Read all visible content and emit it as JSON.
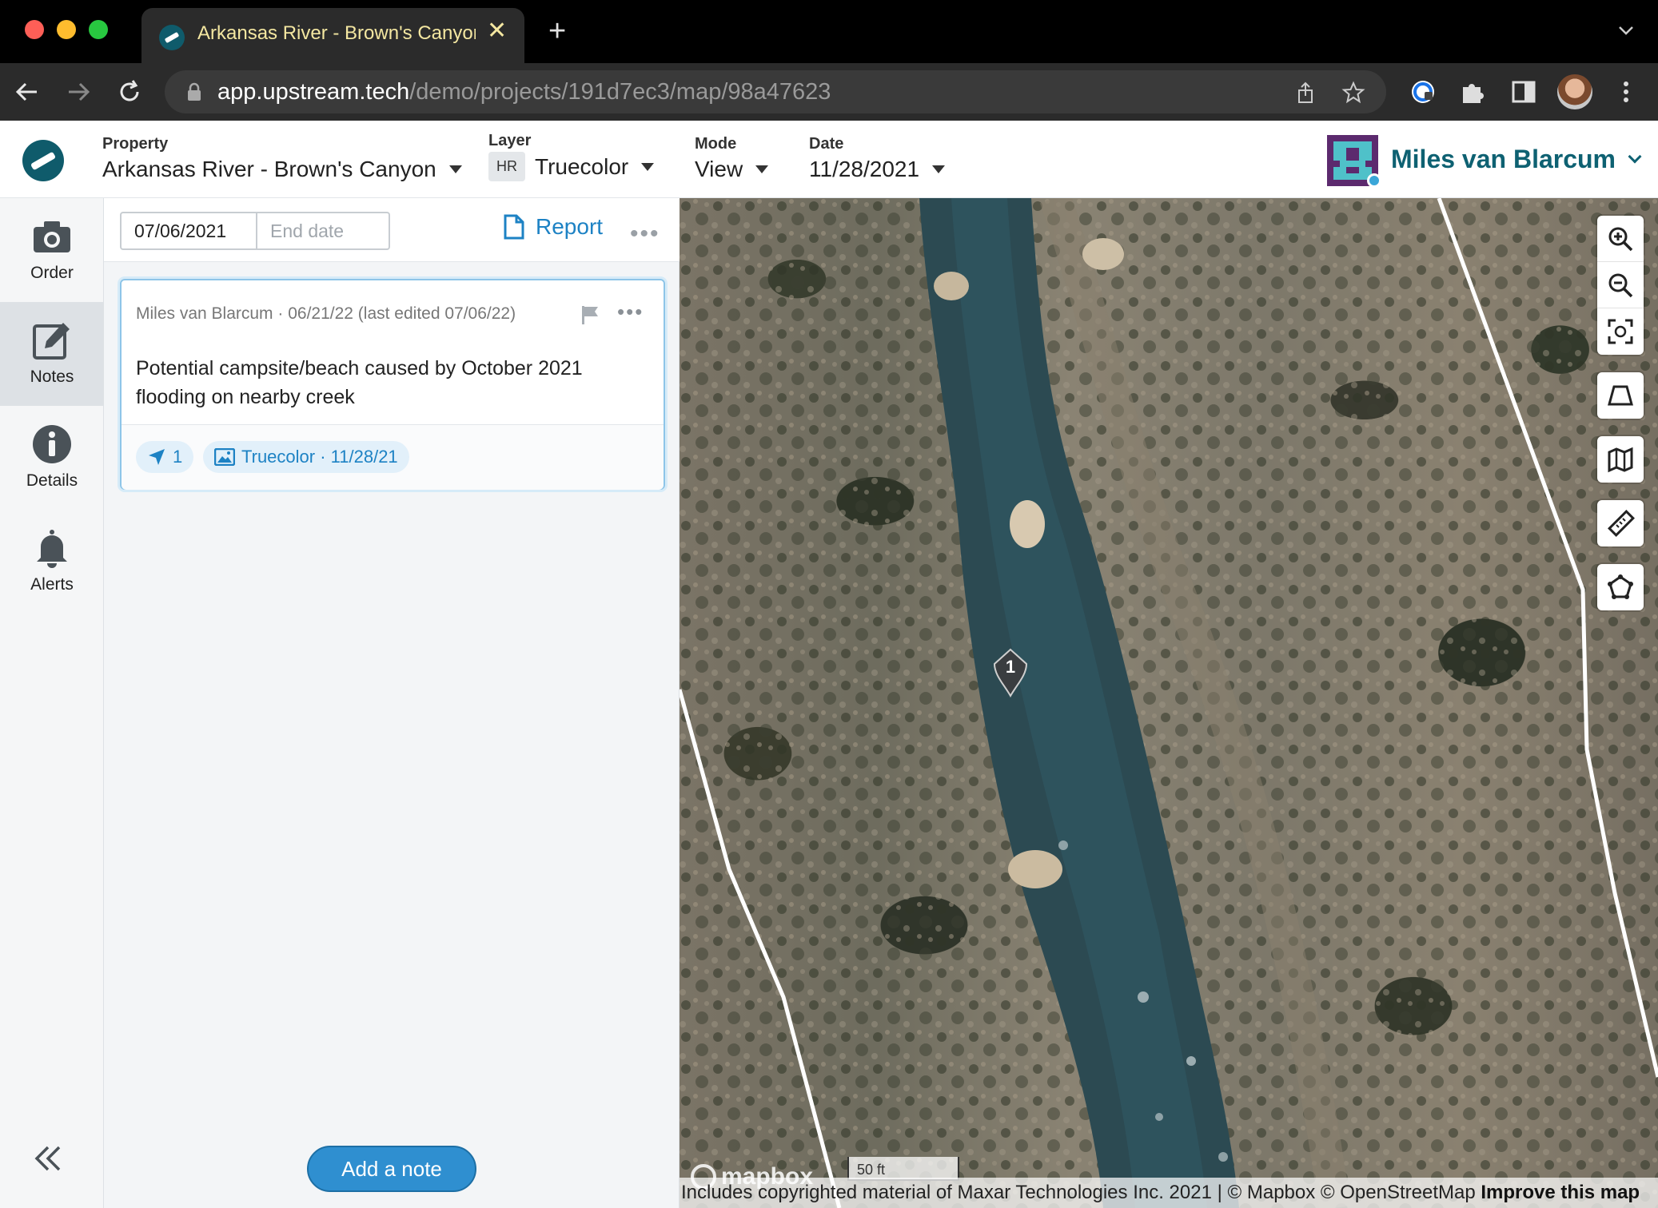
{
  "browser": {
    "tab_title": "Arkansas River - Brown's Canyon",
    "tab_close": "✕",
    "new_tab": "+",
    "url_host": "app.upstream.tech",
    "url_path": "/demo/projects/191d7ec3/map/98a47623"
  },
  "header": {
    "property_label": "Property",
    "property_value": "Arkansas River - Brown's Canyon",
    "layer_label": "Layer",
    "layer_badge": "HR",
    "layer_value": "Truecolor",
    "mode_label": "Mode",
    "mode_value": "View",
    "date_label": "Date",
    "date_value": "11/28/2021",
    "user_name": "Miles van Blarcum"
  },
  "rail": {
    "items": [
      {
        "label": "Order",
        "icon": "camera-icon"
      },
      {
        "label": "Notes",
        "icon": "edit-icon"
      },
      {
        "label": "Details",
        "icon": "info-icon"
      },
      {
        "label": "Alerts",
        "icon": "bell-icon"
      }
    ]
  },
  "panel": {
    "start_date": "07/06/2021",
    "end_date_placeholder": "End date",
    "report_label": "Report",
    "more": "•••",
    "add_note": "Add a note"
  },
  "note": {
    "meta": "Miles van Blarcum · 06/21/22 (last edited 07/06/22)",
    "more": "•••",
    "text": "Potential campsite/beach caused by October 2021 flooding on nearby creek",
    "location_count": "1",
    "layer_chip": "Truecolor · 11/28/21"
  },
  "map": {
    "marker_label": "1",
    "mapbox": "mapbox",
    "scale": "50 ft",
    "attribution": "Includes copyrighted material of Maxar Technologies Inc. 2021 | © Mapbox © OpenStreetMap ",
    "improve": "Improve this map"
  }
}
